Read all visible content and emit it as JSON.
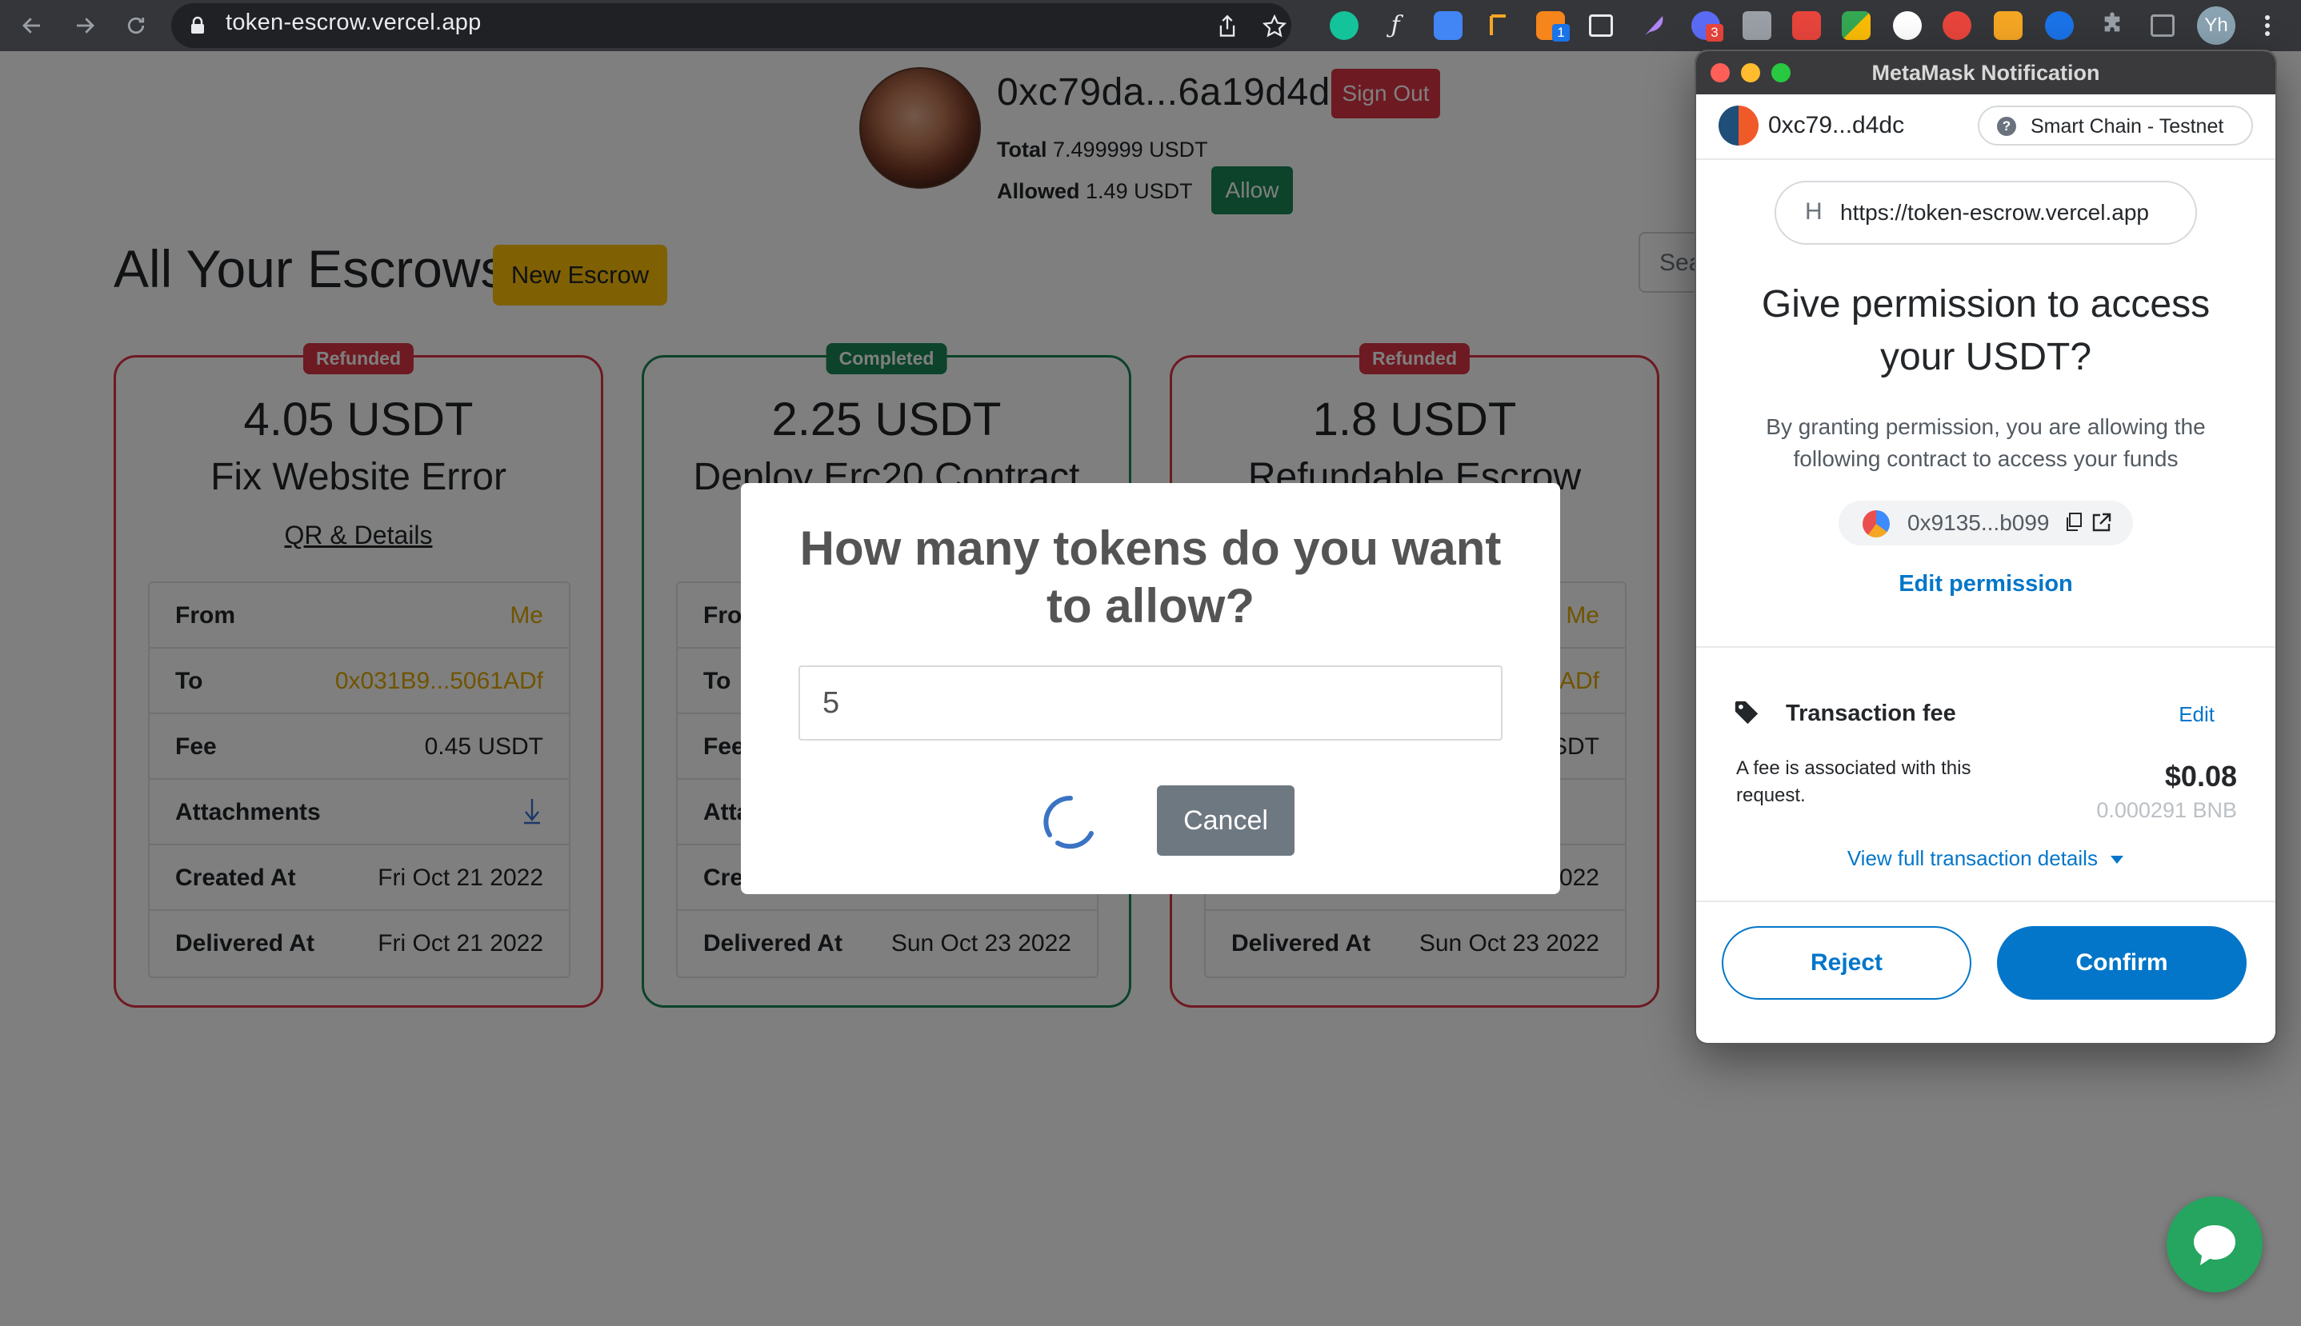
{
  "browser": {
    "url": "token-escrow.vercel.app",
    "profile_initials": "Yh",
    "extension_badges": [
      "1",
      "3"
    ]
  },
  "header": {
    "address": "0xc79da...6a19d4d",
    "sign_out_label": "Sign Out",
    "total_label": "Total",
    "total_value": "7.499999 USDT",
    "allowed_label": "Allowed",
    "allowed_value": "1.49 USDT",
    "allow_label": "Allow"
  },
  "main": {
    "heading": "All Your Escrows",
    "new_escrow_label": "New Escrow",
    "search_placeholder": "Sea"
  },
  "cards": [
    {
      "status": "Refunded",
      "amount": "4.05 USDT",
      "title": "Fix Website Error",
      "link": "QR & Details",
      "rows": [
        {
          "k": "From",
          "v": "Me"
        },
        {
          "k": "To",
          "v": "0x031B9...5061ADf"
        },
        {
          "k": "Fee",
          "v": "0.45 USDT"
        },
        {
          "k": "Attachments",
          "v": ""
        },
        {
          "k": "Created At",
          "v": "Fri Oct 21 2022"
        },
        {
          "k": "Delivered At",
          "v": "Fri Oct 21 2022"
        }
      ]
    },
    {
      "status": "Completed",
      "amount": "2.25 USDT",
      "title": "Deploy Erc20 Contract",
      "rows": [
        {
          "k": "Fro"
        },
        {
          "k": "To"
        },
        {
          "k": "Fee"
        },
        {
          "k": "Atta"
        },
        {
          "k": "Cre"
        },
        {
          "k": "Delivered At",
          "v": "Sun Oct 23 2022"
        }
      ]
    },
    {
      "status": "Refunded",
      "amount": "1.8 USDT",
      "title": "Refundable Escrow",
      "rows": [
        {
          "v": "Me"
        },
        {
          "v": "ADf"
        },
        {
          "v": "SDT"
        },
        {
          "v": ""
        },
        {
          "v": "022"
        },
        {
          "k": "Delivered At",
          "v": "Sun Oct 23 2022"
        }
      ]
    }
  ],
  "modal": {
    "title": "How many tokens do you want to allow?",
    "input_value": "5",
    "cancel_label": "Cancel"
  },
  "metamask": {
    "window_title": "MetaMask Notification",
    "account": "0xc79...d4dc",
    "network": "Smart Chain - Testnet",
    "site_initial": "H",
    "site_url": "https://token-escrow.vercel.app",
    "headline": "Give permission to access your USDT?",
    "description": "By granting permission, you are allowing the following contract to access your funds",
    "contract": "0x9135...b099",
    "edit_permission": "Edit permission",
    "fee_label": "Transaction fee",
    "fee_edit": "Edit",
    "fee_desc": "A fee is associated with this request.",
    "fee_usd": "$0.08",
    "fee_bnb": "0.000291 BNB",
    "view_details": "View full transaction details",
    "reject_label": "Reject",
    "confirm_label": "Confirm"
  },
  "colors": {
    "danger": "#dc3545",
    "success": "#198754",
    "warning": "#ffc107",
    "metamask_blue": "#0376c9",
    "chat_green": "#25a55f"
  },
  "icons": [
    "back-icon",
    "forward-icon",
    "reload-icon",
    "lock-icon",
    "share-icon",
    "star-icon",
    "attachment-icon",
    "copy-icon",
    "external-link-icon",
    "tag-icon",
    "caret-down-icon",
    "chat-icon",
    "spinner-icon"
  ]
}
